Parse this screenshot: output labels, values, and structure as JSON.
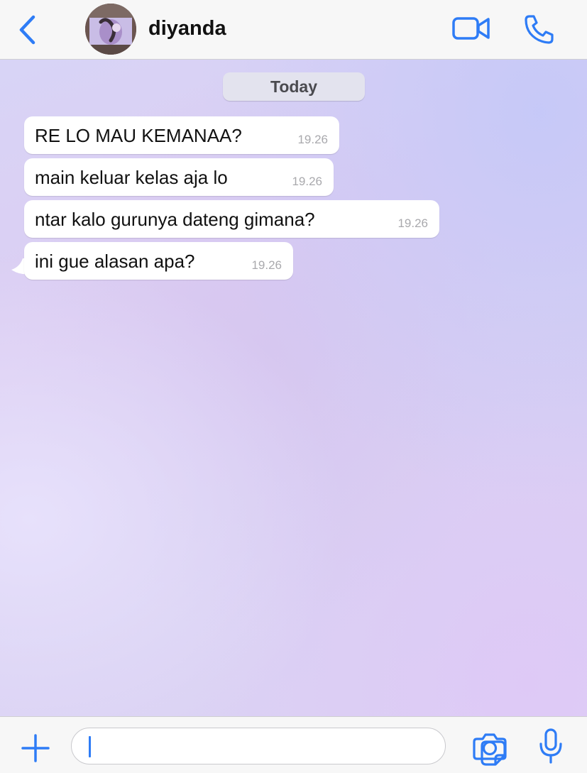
{
  "header": {
    "contact_name": "diyanda"
  },
  "chat": {
    "date_label": "Today",
    "messages": [
      {
        "text": "RE LO MAU KEMANAA?",
        "time": "19.26"
      },
      {
        "text": "main keluar kelas aja lo",
        "time": "19.26"
      },
      {
        "text": "ntar kalo gurunya dateng gimana?",
        "time": "19.26"
      },
      {
        "text": "ini gue alasan apa?",
        "time": "19.26"
      }
    ]
  },
  "composer": {
    "input_value": ""
  },
  "colors": {
    "accent": "#2e7cf6",
    "bubble": "#ffffff",
    "header_bg": "#f7f7f7"
  },
  "icons": [
    "chevron-left-icon",
    "video-camera-icon",
    "phone-icon",
    "plus-icon",
    "sticker-icon",
    "camera-icon",
    "microphone-icon"
  ]
}
